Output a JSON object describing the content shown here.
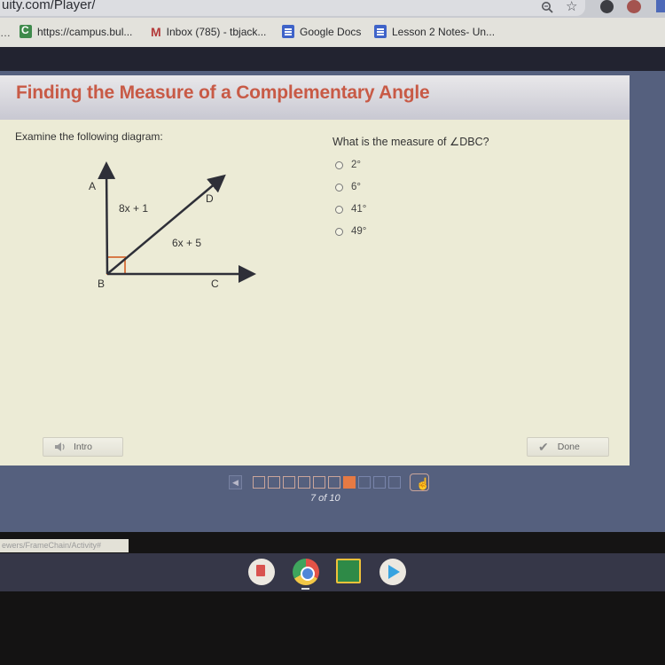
{
  "browser": {
    "url_fragment": "uity.com/Player/",
    "bookmarks": [
      {
        "label": "https://campus.bul...",
        "icon": "campus-icon"
      },
      {
        "label": "Inbox (785) - tbjack...",
        "icon": "gmail-icon"
      },
      {
        "label": "Google Docs",
        "icon": "google-docs-icon"
      },
      {
        "label": "Lesson 2 Notes- Un...",
        "icon": "google-docs-icon"
      }
    ],
    "status_url": "ewers/FrameChain/Activity#"
  },
  "lesson": {
    "title": "Finding the Measure of a Complementary Angle",
    "prompt": "Examine the following diagram:",
    "diagram": {
      "labels": {
        "A": "A",
        "B": "B",
        "C": "C",
        "D": "D"
      },
      "angle_abd": "8x + 1",
      "angle_dbc": "6x + 5",
      "right_angle_at": "B"
    },
    "question": "What is the measure of ∠DBC?",
    "options": [
      "2°",
      "6°",
      "41°",
      "49°"
    ],
    "selected_option": null,
    "intro_label": "Intro",
    "done_label": "Done"
  },
  "pager": {
    "current": 7,
    "total": 10,
    "label": "7 of 10"
  },
  "colors": {
    "title": "#c85a46",
    "current_page": "#e67a44",
    "player_bg": "#55607e",
    "content_bg": "#ecebd6"
  }
}
